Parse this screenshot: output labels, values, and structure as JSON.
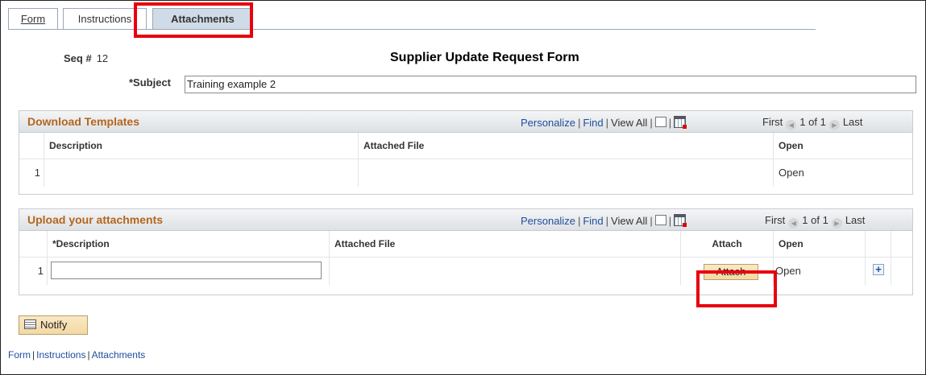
{
  "tabs": {
    "form": "Form",
    "instructions": "Instructions",
    "attachments": "Attachments"
  },
  "header": {
    "seq_label": "Seq #",
    "seq_value": "12",
    "title": "Supplier Update Request Form",
    "subject_label": "*Subject",
    "subject_value": "Training example 2"
  },
  "grid_nav": {
    "personalize": "Personalize",
    "find": "Find",
    "view_all": "View All",
    "first": "First",
    "range": "1 of 1",
    "last": "Last"
  },
  "download_templates": {
    "title": "Download Templates",
    "columns": [
      "Description",
      "Attached File",
      "Open"
    ],
    "rows": [
      {
        "num": "1",
        "description": "",
        "attached_file": "",
        "open": "Open"
      }
    ]
  },
  "upload_attachments": {
    "title": "Upload your attachments",
    "columns": [
      "*Description",
      "Attached File",
      "Attach",
      "Open"
    ],
    "rows": [
      {
        "num": "1",
        "description": "",
        "attached_file": "",
        "attach_button": "Attach",
        "open": "Open"
      }
    ]
  },
  "notify_button": "Notify",
  "footer_links": [
    "Form",
    "Instructions",
    "Attachments"
  ],
  "colors": {
    "highlight": "#e8000d",
    "section_title": "#b5651d",
    "link": "#1f4e9c"
  },
  "icons": [
    "download-excel-icon",
    "zoom-grid-icon",
    "first-arrow-icon",
    "last-arrow-icon",
    "add-row-icon",
    "notify-icon"
  ]
}
